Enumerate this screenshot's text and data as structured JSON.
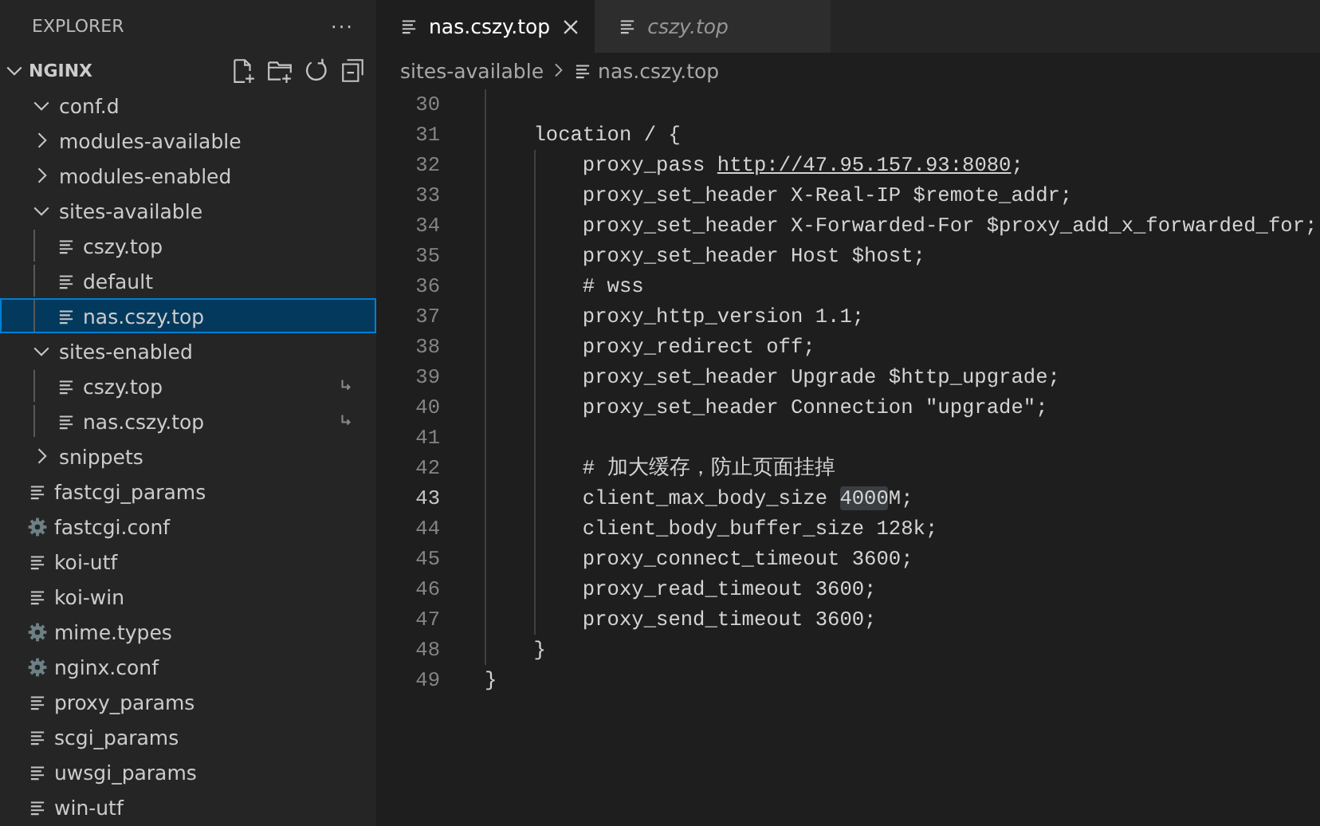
{
  "sidebar": {
    "title": "EXPLORER",
    "more": "···",
    "root": {
      "label": "NGINX",
      "expanded": true
    },
    "items": [
      {
        "kind": "folder",
        "label": "conf.d",
        "expanded": true,
        "selected": false
      },
      {
        "kind": "folder",
        "label": "modules-available",
        "expanded": false,
        "selected": false
      },
      {
        "kind": "folder",
        "label": "modules-enabled",
        "expanded": false,
        "selected": false
      },
      {
        "kind": "folder",
        "label": "sites-available",
        "expanded": true,
        "selected": false,
        "children": [
          {
            "kind": "file",
            "label": "cszy.top",
            "selected": false,
            "symlink": false
          },
          {
            "kind": "file",
            "label": "default",
            "selected": false,
            "symlink": false
          },
          {
            "kind": "file",
            "label": "nas.cszy.top",
            "selected": true,
            "symlink": false
          }
        ]
      },
      {
        "kind": "folder",
        "label": "sites-enabled",
        "expanded": true,
        "selected": false,
        "children": [
          {
            "kind": "file",
            "label": "cszy.top",
            "selected": false,
            "symlink": true
          },
          {
            "kind": "file",
            "label": "nas.cszy.top",
            "selected": false,
            "symlink": true
          }
        ]
      },
      {
        "kind": "folder",
        "label": "snippets",
        "expanded": false,
        "selected": false
      },
      {
        "kind": "file",
        "label": "fastcgi_params",
        "selected": false,
        "symlink": false
      },
      {
        "kind": "config",
        "label": "fastcgi.conf",
        "selected": false,
        "symlink": false
      },
      {
        "kind": "file",
        "label": "koi-utf",
        "selected": false,
        "symlink": false
      },
      {
        "kind": "file",
        "label": "koi-win",
        "selected": false,
        "symlink": false
      },
      {
        "kind": "config",
        "label": "mime.types",
        "selected": false,
        "symlink": false
      },
      {
        "kind": "config",
        "label": "nginx.conf",
        "selected": false,
        "symlink": false
      },
      {
        "kind": "file",
        "label": "proxy_params",
        "selected": false,
        "symlink": false
      },
      {
        "kind": "file",
        "label": "scgi_params",
        "selected": false,
        "symlink": false
      },
      {
        "kind": "file",
        "label": "uwsgi_params",
        "selected": false,
        "symlink": false
      },
      {
        "kind": "file",
        "label": "win-utf",
        "selected": false,
        "symlink": false
      }
    ]
  },
  "tabs": [
    {
      "label": "nas.cszy.top",
      "selected": true,
      "preview": false
    },
    {
      "label": "cszy.top",
      "selected": false,
      "preview": true
    }
  ],
  "breadcrumb": [
    "sites-available",
    "nas.cszy.top"
  ],
  "code": [
    {
      "number": "30",
      "current": false
    },
    {
      "number": "31",
      "current": false,
      "parts": [
        {
          "text": "    location / {"
        }
      ]
    },
    {
      "number": "32",
      "current": false,
      "parts": [
        {
          "text": "        proxy_pass "
        },
        {
          "text": "http://47.95.157.93:8080",
          "link": true
        },
        {
          "text": ";"
        }
      ]
    },
    {
      "number": "33",
      "current": false,
      "parts": [
        {
          "text": "        proxy_set_header X-Real-IP $remote_addr;"
        }
      ]
    },
    {
      "number": "34",
      "current": false,
      "parts": [
        {
          "text": "        proxy_set_header X-Forwarded-For $proxy_add_x_forwarded_for;"
        }
      ]
    },
    {
      "number": "35",
      "current": false,
      "parts": [
        {
          "text": "        proxy_set_header Host $host;"
        }
      ]
    },
    {
      "number": "36",
      "current": false,
      "parts": [
        {
          "text": "        # wss"
        }
      ]
    },
    {
      "number": "37",
      "current": false,
      "parts": [
        {
          "text": "        proxy_http_version 1.1;"
        }
      ]
    },
    {
      "number": "38",
      "current": false,
      "parts": [
        {
          "text": "        proxy_redirect off;"
        }
      ]
    },
    {
      "number": "39",
      "current": false,
      "parts": [
        {
          "text": "        proxy_set_header Upgrade $http_upgrade;"
        }
      ]
    },
    {
      "number": "40",
      "current": false,
      "parts": [
        {
          "text": "        proxy_set_header Connection \"upgrade\";"
        }
      ]
    },
    {
      "number": "41",
      "current": false
    },
    {
      "number": "42",
      "current": false,
      "parts": [
        {
          "text": "        # 加大缓存，防止页面挂掉"
        }
      ]
    },
    {
      "number": "43",
      "current": true,
      "parts": [
        {
          "text": "        client_max_body_size "
        },
        {
          "text": "4000",
          "highlighted": true
        },
        {
          "text": "M;"
        }
      ]
    },
    {
      "number": "44",
      "current": false,
      "parts": [
        {
          "text": "        client_body_buffer_size 128k;"
        }
      ]
    },
    {
      "number": "45",
      "current": false,
      "parts": [
        {
          "text": "        proxy_connect_timeout 3600;"
        }
      ]
    },
    {
      "number": "46",
      "current": false,
      "parts": [
        {
          "text": "        proxy_read_timeout 3600;"
        }
      ]
    },
    {
      "number": "47",
      "current": false,
      "parts": [
        {
          "text": "        proxy_send_timeout 3600;"
        }
      ]
    },
    {
      "number": "48",
      "current": false,
      "parts": [
        {
          "text": "    }"
        }
      ]
    },
    {
      "number": "49",
      "current": false,
      "parts": [
        {
          "text": "}"
        }
      ]
    }
  ]
}
